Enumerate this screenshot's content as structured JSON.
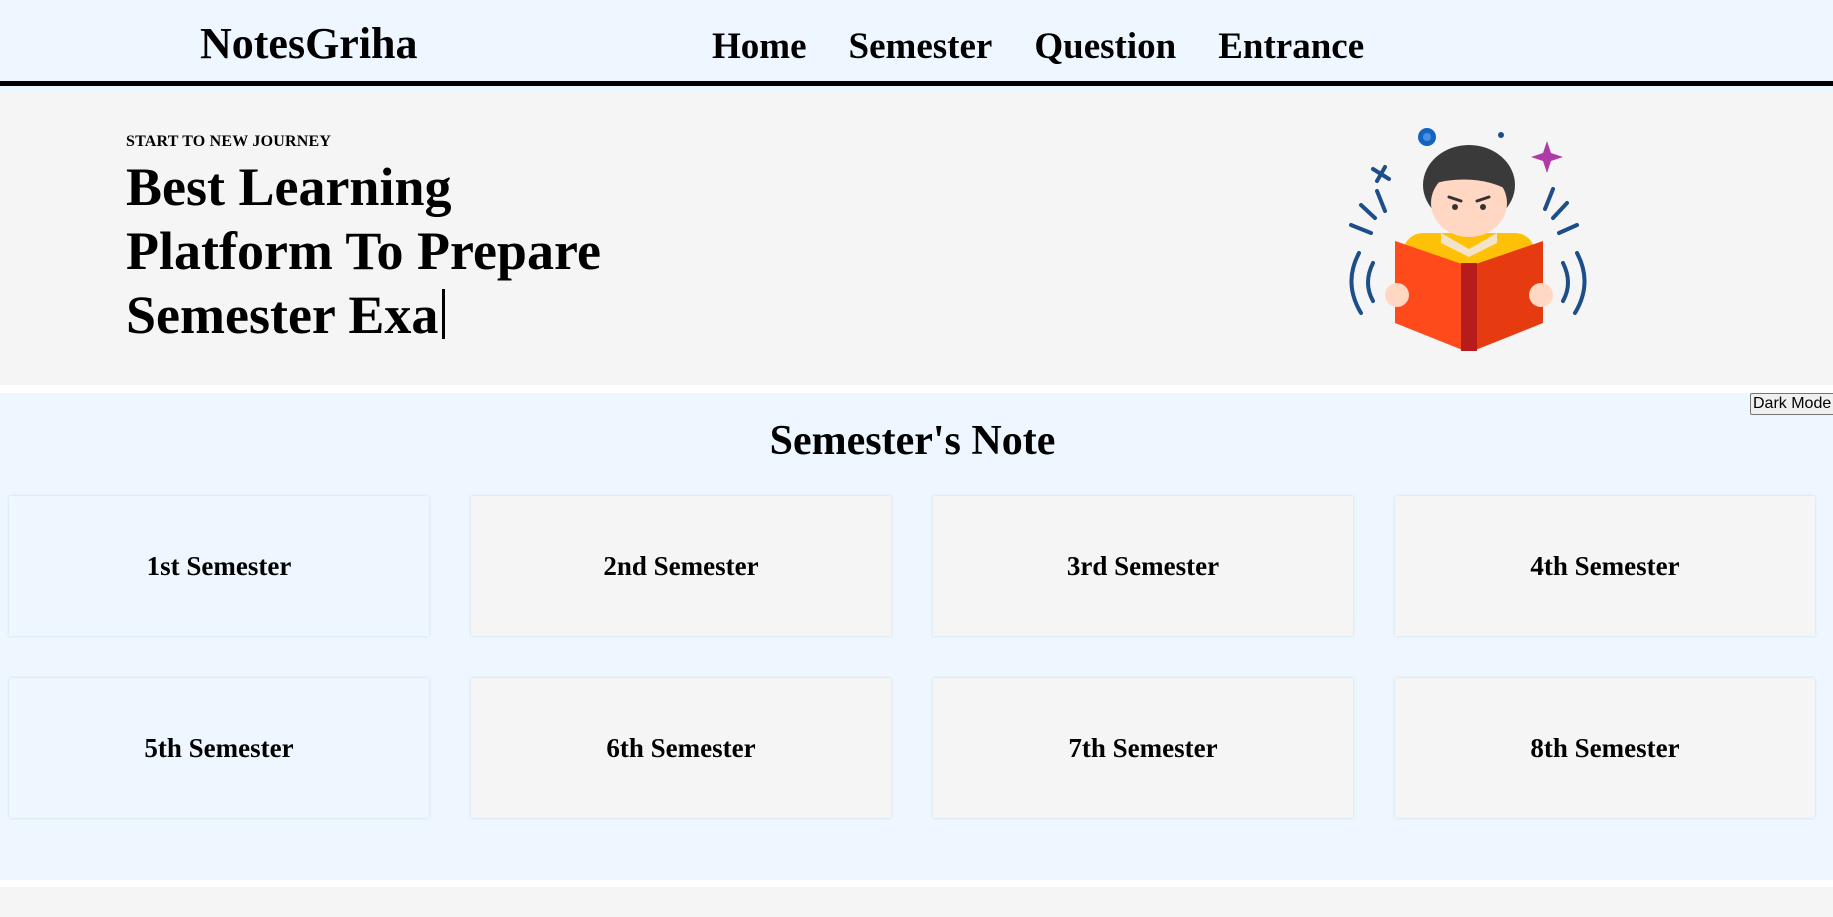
{
  "header": {
    "brand": "NotesGriha",
    "nav": [
      {
        "label": "Home"
      },
      {
        "label": "Semester"
      },
      {
        "label": "Question"
      },
      {
        "label": "Entrance"
      }
    ]
  },
  "hero": {
    "kicker": "START TO NEW JOURNEY",
    "title_line1": "Best Learning",
    "title_line2": "Platform To Prepare",
    "title_line3": "Semester Exa",
    "illustration_icon": "boy-reading-book-icon"
  },
  "dark_mode_label": "Dark Mode",
  "section": {
    "title": "Semester's Note",
    "cards": [
      {
        "label": "1st Semester"
      },
      {
        "label": "2nd Semester"
      },
      {
        "label": "3rd Semester"
      },
      {
        "label": "4th Semester"
      },
      {
        "label": "5th Semester"
      },
      {
        "label": "6th Semester"
      },
      {
        "label": "7th Semester"
      },
      {
        "label": "8th Semester"
      }
    ]
  },
  "colors": {
    "page_bg": "#eef7ff",
    "hero_bg": "#f5f5f5",
    "book_red": "#ff4a1c",
    "hair": "#3a3a3a",
    "motion_lines": "#1d4e89"
  }
}
